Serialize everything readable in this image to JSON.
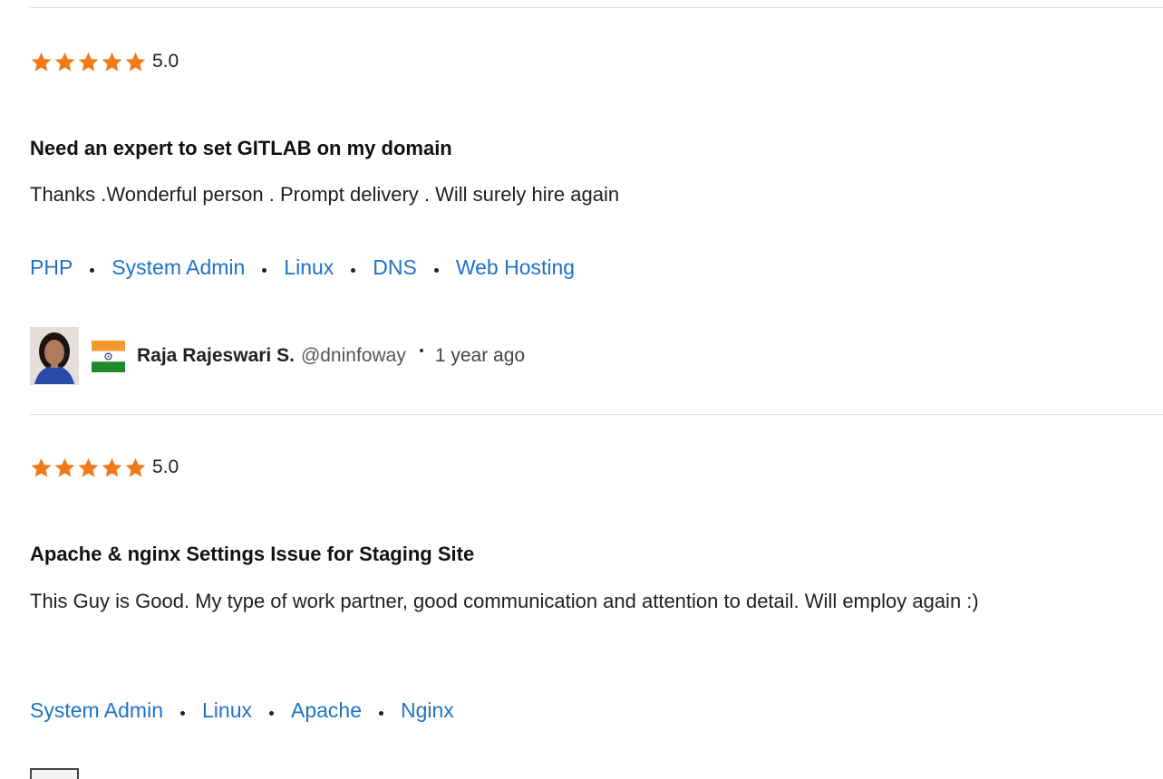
{
  "reviews": [
    {
      "rating": 5,
      "score_label": "5.0",
      "title": "Need an expert to set GITLAB on my domain",
      "text": "Thanks .Wonderful person . Prompt delivery . Will surely hire again",
      "tags": [
        "PHP",
        "System Admin",
        "Linux",
        "DNS",
        "Web Hosting"
      ],
      "author": {
        "name": "Raja Rajeswari S.",
        "handle": "@dninfoway",
        "time_ago": "1 year ago",
        "flag_icon": "india-flag-icon",
        "avatar_icon": "user-avatar"
      }
    },
    {
      "rating": 5,
      "score_label": "5.0",
      "title": "Apache & nginx Settings Issue for Staging Site",
      "text": "This Guy is Good. My type of work partner, good communication and attention to detail. Will employ again :)",
      "tags": [
        "System Admin",
        "Linux",
        "Apache",
        "Nginx"
      ]
    }
  ],
  "colors": {
    "star": "#f07a1a",
    "link": "#1e72c6",
    "divider": "#dcdcdc"
  }
}
